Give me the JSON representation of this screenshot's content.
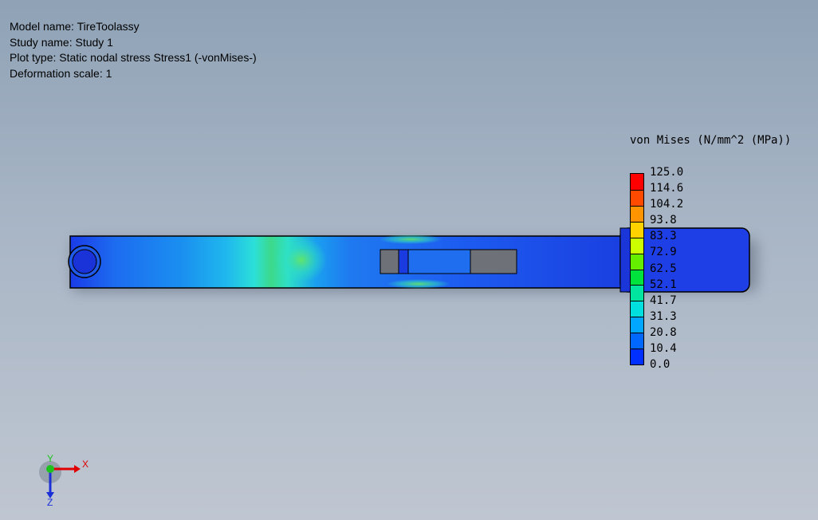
{
  "info": {
    "model_name": "Model name: TireToolassy",
    "study_name": "Study name: Study 1",
    "plot_type": "Plot type: Static nodal stress Stress1 (-vonMises-)",
    "deformation_scale": "Deformation scale: 1"
  },
  "legend": {
    "title": "von Mises (N/mm^2 (MPa))",
    "values": [
      "125.0",
      "114.6",
      "104.2",
      "93.8",
      "83.3",
      "72.9",
      "62.5",
      "52.1",
      "41.7",
      "31.3",
      "20.8",
      "10.4",
      "0.0"
    ],
    "colors": [
      "#ff0000",
      "#ff4a00",
      "#ff9400",
      "#ffd200",
      "#ccff00",
      "#66ee00",
      "#00e23c",
      "#00e4a0",
      "#00dede",
      "#00a6ff",
      "#0068ff",
      "#0030ff"
    ]
  },
  "triad": {
    "x_label": "X",
    "y_label": "Y",
    "z_label": "Z"
  },
  "colors": {
    "part_blue": "#1f3fe6",
    "background_top": "#8fa2b6",
    "background_bottom": "#bfc6d1",
    "slot_gray": "#6e7178"
  }
}
